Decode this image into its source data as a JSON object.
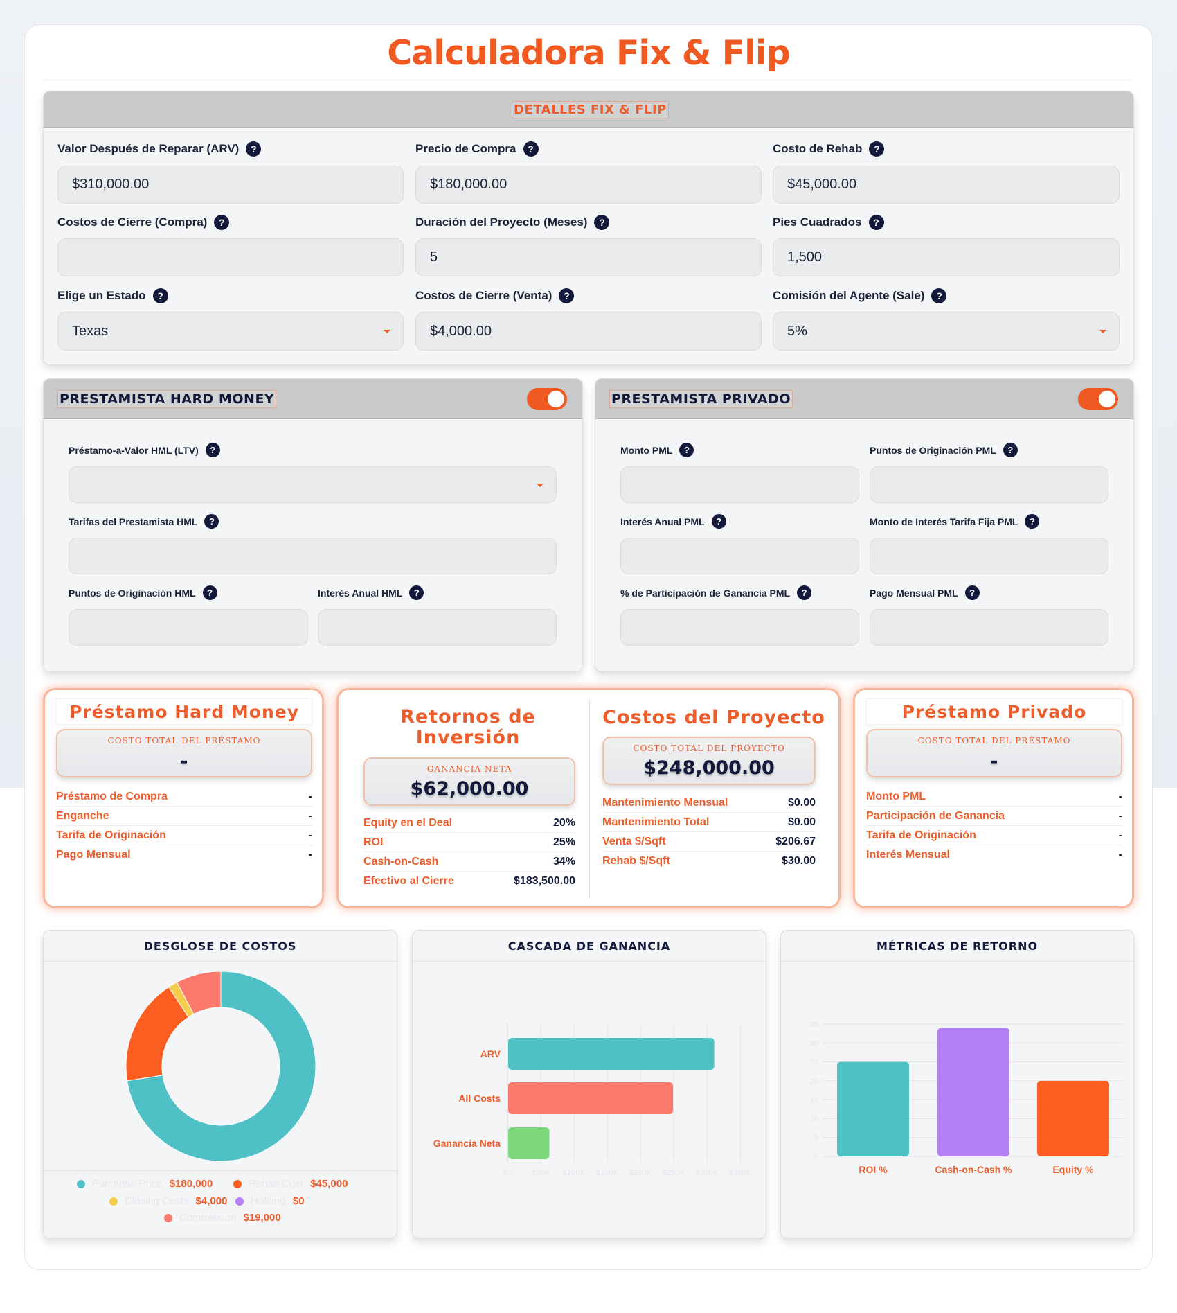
{
  "app": {
    "title": "Calculadora Fix & Flip"
  },
  "details": {
    "header": "DETALLES FIX & FLIP",
    "fields": [
      {
        "label": "Valor Después de Reparar (ARV)",
        "value": "$310,000.00"
      },
      {
        "label": "Precio de Compra",
        "value": "$180,000.00"
      },
      {
        "label": "Costo de Rehab",
        "value": "$45,000.00"
      },
      {
        "label": "Costos de Cierre (Compra)",
        "value": ""
      },
      {
        "label": "Duración del Proyecto (Meses)",
        "value": "5"
      },
      {
        "label": "Pies Cuadrados",
        "value": "1,500"
      },
      {
        "label": "Elige un Estado",
        "value": "Texas"
      },
      {
        "label": "Costos de Cierre (Venta)",
        "value": "$4,000.00"
      },
      {
        "label": "Comisión del Agente (Sale)",
        "value": "5%"
      }
    ]
  },
  "hml": {
    "header": "PRESTAMISTA HARD MONEY",
    "enabled": true,
    "fields": [
      {
        "label": "Préstamo-a-Valor HML (LTV)",
        "value": ""
      },
      {
        "label": "Tarifas del Prestamista HML",
        "value": ""
      },
      {
        "label": "Puntos de Originación HML",
        "value": ""
      },
      {
        "label": "Interés Anual HML",
        "value": ""
      }
    ]
  },
  "pml": {
    "header": "PRESTAMISTA PRIVADO",
    "enabled": true,
    "fields": [
      {
        "label": "Monto PML",
        "value": ""
      },
      {
        "label": "Puntos de Originación PML",
        "value": ""
      },
      {
        "label": "Interés Anual PML",
        "value": ""
      },
      {
        "label": "Monto de Interés Tarifa Fija PML",
        "value": ""
      },
      {
        "label": "% de Participación de Ganancia PML",
        "value": ""
      },
      {
        "label": "Pago Mensual PML",
        "value": ""
      }
    ]
  },
  "help_glyph": "?",
  "hard_money_card": {
    "title": "Préstamo Hard Money",
    "stat_caption": "COSTO TOTAL DEL PRÉSTAMO",
    "stat_value": "-",
    "rows": [
      {
        "k": "Préstamo de Compra",
        "v": "-"
      },
      {
        "k": "Enganche",
        "v": "-"
      },
      {
        "k": "Tarifa de Originación",
        "v": "-"
      },
      {
        "k": "Pago Mensual",
        "v": "-"
      }
    ]
  },
  "returns_card": {
    "title_line1": "Retornos de",
    "title_line2": "Inversión",
    "stat_caption": "GANANCIA NETA",
    "stat_value": "$62,000.00",
    "rows": [
      {
        "k": "Equity en el Deal",
        "v": "20%"
      },
      {
        "k": "ROI",
        "v": "25%"
      },
      {
        "k": "Cash-on-Cash",
        "v": "34%"
      },
      {
        "k": "Efectivo al Cierre",
        "v": "$183,500.00"
      }
    ]
  },
  "costs_card": {
    "title": "Costos del Proyecto",
    "stat_caption": "COSTO TOTAL DEL PROYECTO",
    "stat_value": "$248,000.00",
    "rows": [
      {
        "k": "Mantenimiento Mensual",
        "v": "$0.00"
      },
      {
        "k": "Mantenimiento Total",
        "v": "$0.00"
      },
      {
        "k": "Venta $/Sqft",
        "v": "$206.67"
      },
      {
        "k": "Rehab $/Sqft",
        "v": "$30.00"
      }
    ]
  },
  "private_card": {
    "title": "Préstamo Privado",
    "stat_caption": "COSTO TOTAL DEL PRÉSTAMO",
    "stat_value": "-",
    "rows": [
      {
        "k": "Monto PML",
        "v": "-"
      },
      {
        "k": "Participación de Ganancia",
        "v": "-"
      },
      {
        "k": "Tarifa de Originación",
        "v": "-"
      },
      {
        "k": "Interés Mensual",
        "v": "-"
      }
    ]
  },
  "charts": {
    "cost_breakdown_title": "DESGLOSE DE COSTOS",
    "waterfall_title": "CASCADA DE GANANCIA",
    "metrics_title": "MÉTRICAS DE RETORNO",
    "legend": [
      {
        "value": "$180,000",
        "color": "#4fc1c6"
      },
      {
        "value": "$45,000",
        "color": "#fb5e20"
      },
      {
        "value": "$4,000",
        "color": "#f6cd4a"
      },
      {
        "value": "$0",
        "color": "#b57ff6"
      },
      {
        "value": "$19,000",
        "color": "#fb7a6c"
      }
    ]
  },
  "chart_data": [
    {
      "type": "pie",
      "title": "DESGLOSE DE COSTOS",
      "values": [
        180000,
        45000,
        4000,
        0,
        19000
      ],
      "colors": [
        "#4fc1c6",
        "#fb5e20",
        "#f6cd4a",
        "#b57ff6",
        "#fb7a6c"
      ]
    },
    {
      "type": "bar",
      "orientation": "horizontal",
      "title": "CASCADA DE GANANCIA",
      "categories": [
        "ARV",
        "All Costs",
        "Ganancia Neta"
      ],
      "values": [
        310000,
        248000,
        62000
      ],
      "colors": [
        "#4fc1c6",
        "#fb7a6c",
        "#7dd87b"
      ],
      "xlim": [
        0,
        350000
      ],
      "grid": true
    },
    {
      "type": "bar",
      "title": "MÉTRICAS DE RETORNO",
      "categories": [
        "ROI %",
        "Cash-on-Cash %",
        "Equity %"
      ],
      "values": [
        25,
        34,
        20
      ],
      "colors": [
        "#4fc1c6",
        "#b57ff6",
        "#fb5e20"
      ],
      "ylim": [
        0,
        35
      ],
      "grid": true
    }
  ]
}
